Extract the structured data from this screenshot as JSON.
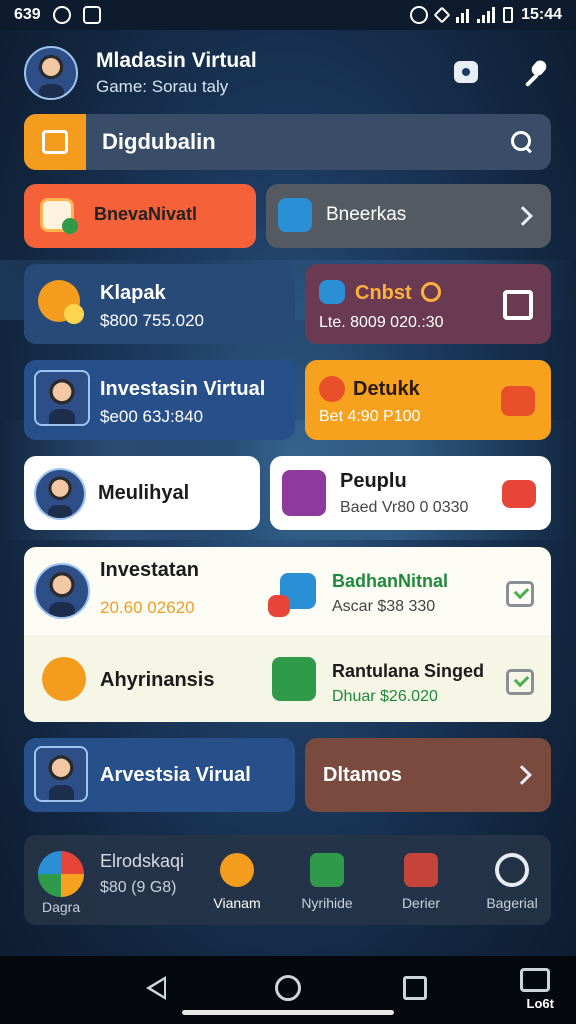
{
  "status": {
    "time_left": "639",
    "time_right": "15:44"
  },
  "header": {
    "name": "Mladasin Virtual",
    "subtitle": "Game: Sorau taly"
  },
  "search": {
    "label": "Digdubalin"
  },
  "row1": {
    "left_label": "BnevaNivatl",
    "right_label": "Bneerkas"
  },
  "row2": {
    "left": {
      "title": "Klapak",
      "sub": "$800 755.020"
    },
    "right": {
      "title": "Cnbst",
      "sub": "Lte. 8009 020.:30"
    }
  },
  "row3": {
    "left": {
      "title": "Investasin Virtual",
      "sub": "$e00 63J:840"
    },
    "right": {
      "title": "Detukk",
      "sub": "Bet 4:90 P100"
    }
  },
  "row4": {
    "left": {
      "title": "Meulihyal"
    },
    "right": {
      "title": "Peuplu",
      "sub": "Baed Vr80 0 0330"
    }
  },
  "row5": {
    "a": {
      "title": "Investatan",
      "sub": "20.60 02620"
    },
    "b": {
      "title": "BadhanNitnal",
      "sub": "Ascar $38 330"
    },
    "c": {
      "title": "Ahyrinansis"
    },
    "d": {
      "title": "Rantulana Singed",
      "sub": "Dhuar $26.020"
    }
  },
  "row6": {
    "left": "Arvestsia Virual",
    "right": "Dltamos"
  },
  "bottom_nav": {
    "card_title": "Elrodskaqi",
    "card_sub": "$80 (9 G8)",
    "card_label": "Dagra",
    "items": [
      "Vianam",
      "Nyrihide",
      "Derier",
      "Bagerial"
    ]
  },
  "sys": {
    "corner_label": "Lo6t"
  },
  "colors": {
    "orange": "#f5623a",
    "amber": "#f7a21e",
    "navy_card": "#274a79",
    "plum": "#6a3a52",
    "brown": "#7a4a3f"
  }
}
